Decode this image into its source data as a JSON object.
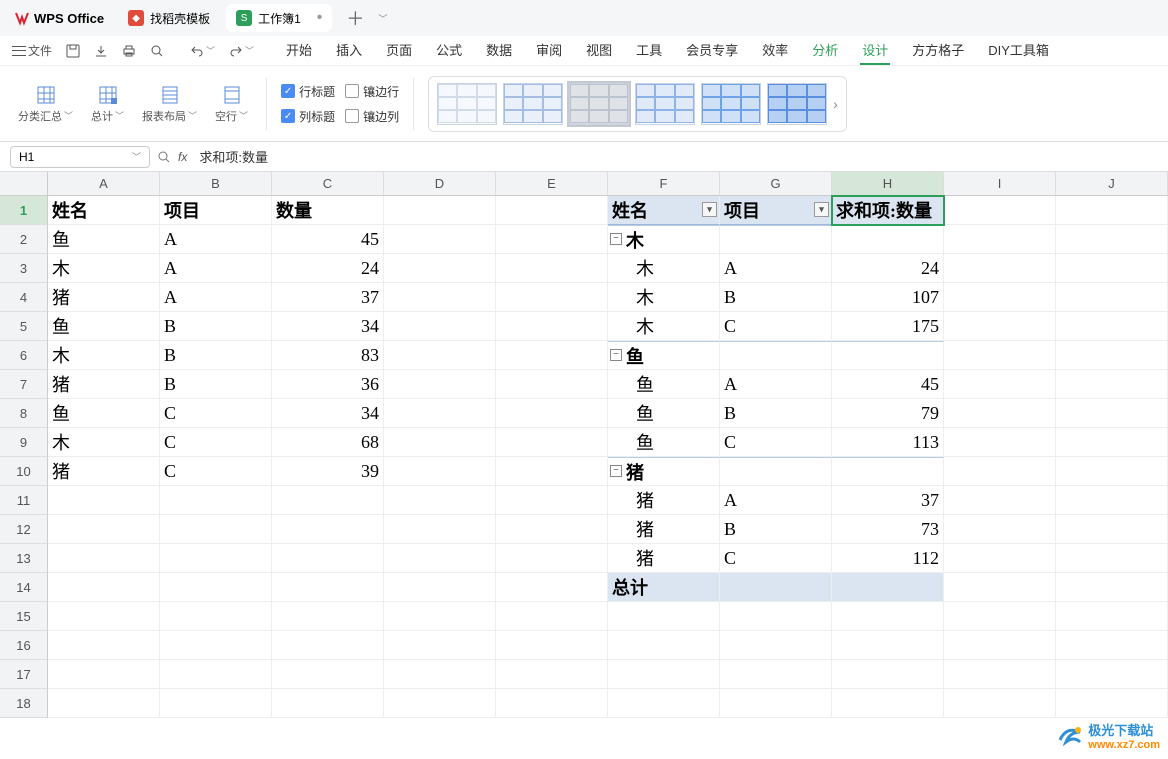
{
  "titlebar": {
    "app_name": "WPS Office",
    "tabs": [
      {
        "label": "找稻壳模板",
        "icon": "red"
      },
      {
        "label": "工作簿1",
        "icon": "green"
      }
    ],
    "add": "＋"
  },
  "qa": {
    "file": "文件"
  },
  "ribbon_tabs": [
    "开始",
    "插入",
    "页面",
    "公式",
    "数据",
    "审阅",
    "视图",
    "工具",
    "会员专享",
    "效率",
    "分析",
    "设计",
    "方方格子",
    "DIY工具箱"
  ],
  "ribbon": {
    "g1": "分类汇总",
    "g2": "总计",
    "g3": "报表布局",
    "g4": "空行",
    "chk_row_hdr": "行标题",
    "chk_col_hdr": "列标题",
    "chk_row_band": "镶边行",
    "chk_col_band": "镶边列"
  },
  "formula_bar": {
    "namebox": "H1",
    "fx": "fx",
    "content": "求和项:数量"
  },
  "columns": [
    "A",
    "B",
    "C",
    "D",
    "E",
    "F",
    "G",
    "H",
    "I",
    "J"
  ],
  "rows_count": 18,
  "left_table": {
    "headers": [
      "姓名",
      "项目",
      "数量"
    ],
    "rows": [
      [
        "鱼",
        "A",
        "45"
      ],
      [
        "木",
        "A",
        "24"
      ],
      [
        "猪",
        "A",
        "37"
      ],
      [
        "鱼",
        "B",
        "34"
      ],
      [
        "木",
        "B",
        "83"
      ],
      [
        "猪",
        "B",
        "36"
      ],
      [
        "鱼",
        "C",
        "34"
      ],
      [
        "木",
        "C",
        "68"
      ],
      [
        "猪",
        "C",
        "39"
      ]
    ]
  },
  "pivot": {
    "h_name": "姓名",
    "h_item": "项目",
    "h_sum": "求和项:数量",
    "groups": [
      {
        "name": "木",
        "rows": [
          [
            "木",
            "A",
            "24"
          ],
          [
            "木",
            "B",
            "107"
          ],
          [
            "木",
            "C",
            "175"
          ]
        ]
      },
      {
        "name": "鱼",
        "rows": [
          [
            "鱼",
            "A",
            "45"
          ],
          [
            "鱼",
            "B",
            "79"
          ],
          [
            "鱼",
            "C",
            "113"
          ]
        ]
      },
      {
        "name": "猪",
        "rows": [
          [
            "猪",
            "A",
            "37"
          ],
          [
            "猪",
            "B",
            "73"
          ],
          [
            "猪",
            "C",
            "112"
          ]
        ]
      }
    ],
    "total_label": "总计"
  },
  "watermark": {
    "brand": "极光下载站",
    "url": "www.xz7.com"
  }
}
